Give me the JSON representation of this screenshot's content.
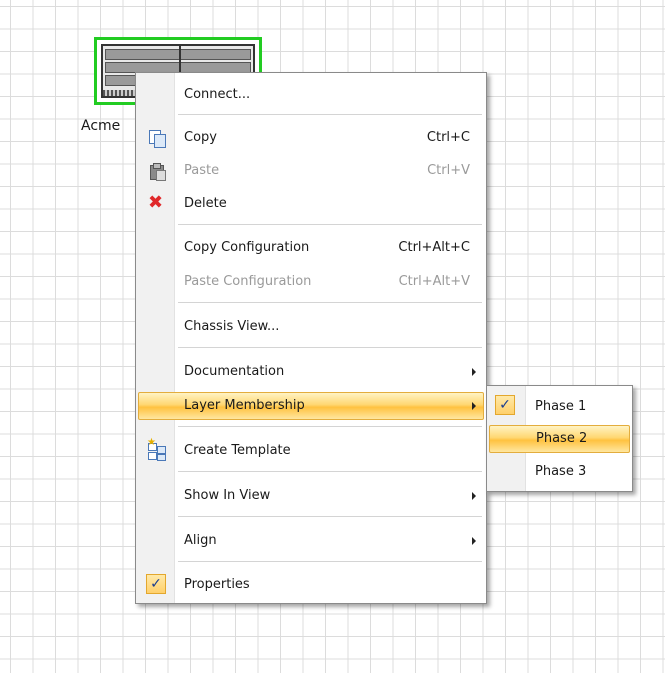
{
  "canvas": {
    "device_label": "Acme"
  },
  "context_menu": {
    "items": [
      {
        "label": "Connect..."
      },
      {
        "label": "Copy",
        "shortcut": "Ctrl+C",
        "icon": "copy-icon"
      },
      {
        "label": "Paste",
        "shortcut": "Ctrl+V",
        "icon": "paste-icon",
        "disabled": true
      },
      {
        "label": "Delete",
        "icon": "delete-icon"
      },
      {
        "label": "Copy Configuration",
        "shortcut": "Ctrl+Alt+C"
      },
      {
        "label": "Paste Configuration",
        "shortcut": "Ctrl+Alt+V",
        "disabled": true
      },
      {
        "label": "Chassis View..."
      },
      {
        "label": "Documentation",
        "submenu": true
      },
      {
        "label": "Layer Membership",
        "submenu": true,
        "highlighted": true
      },
      {
        "label": "Create Template",
        "icon": "template-icon"
      },
      {
        "label": "Show In View",
        "submenu": true
      },
      {
        "label": "Align",
        "submenu": true
      },
      {
        "label": "Properties",
        "checked": true
      }
    ]
  },
  "layer_submenu": {
    "items": [
      {
        "label": "Phase 1",
        "checked": true
      },
      {
        "label": "Phase 2",
        "highlighted": true
      },
      {
        "label": "Phase 3"
      }
    ]
  },
  "check_glyph": "✓",
  "colors": {
    "highlight": "#ffd771",
    "selection_border": "#22cc22",
    "delete_icon": "#e0282a"
  }
}
